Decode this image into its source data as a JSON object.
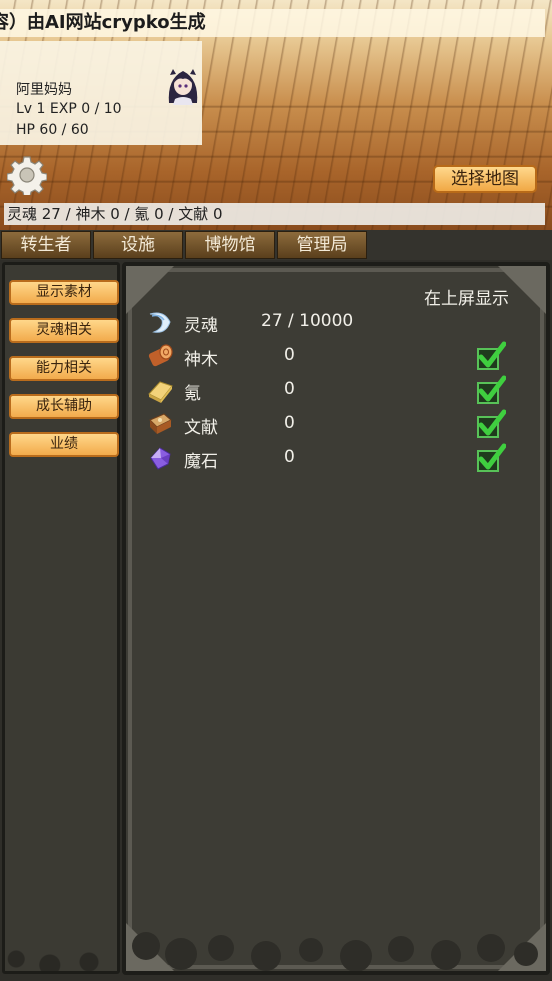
{
  "banner": {
    "text": "容）由AI网站crypko生成"
  },
  "character": {
    "name": "阿里妈妈",
    "level": "Lv 1 EXP 0 / 10",
    "hp": "HP 60 / 60"
  },
  "map_button": {
    "label": "选择地图"
  },
  "resource_bar": {
    "text": "灵魂 27 / 神木 0 / 氪 0 / 文献 0"
  },
  "tabs": [
    {
      "label": "转生者"
    },
    {
      "label": "设施"
    },
    {
      "label": "博物馆"
    },
    {
      "label": "管理局"
    }
  ],
  "sidebar": {
    "items": [
      {
        "label": "显示素材"
      },
      {
        "label": "灵魂相关"
      },
      {
        "label": "能力相关"
      },
      {
        "label": "成长辅助"
      },
      {
        "label": "业绩"
      }
    ]
  },
  "panel": {
    "header": "在上屏显示",
    "materials": [
      {
        "name": "灵魂",
        "value": "27 / 10000",
        "icon": "soul-icon",
        "checked": false
      },
      {
        "name": "神木",
        "value": "0",
        "icon": "wood-log-icon",
        "checked": true
      },
      {
        "name": "氪",
        "value": "0",
        "icon": "gold-bar-icon",
        "checked": true
      },
      {
        "name": "文献",
        "value": "0",
        "icon": "book-icon",
        "checked": true
      },
      {
        "name": "魔石",
        "value": "0",
        "icon": "magic-crystal-icon",
        "checked": true
      }
    ]
  },
  "colors": {
    "button_orange": "#f2ab4c",
    "panel_bg": "#3d3c35",
    "check_green": "#3db83d"
  }
}
